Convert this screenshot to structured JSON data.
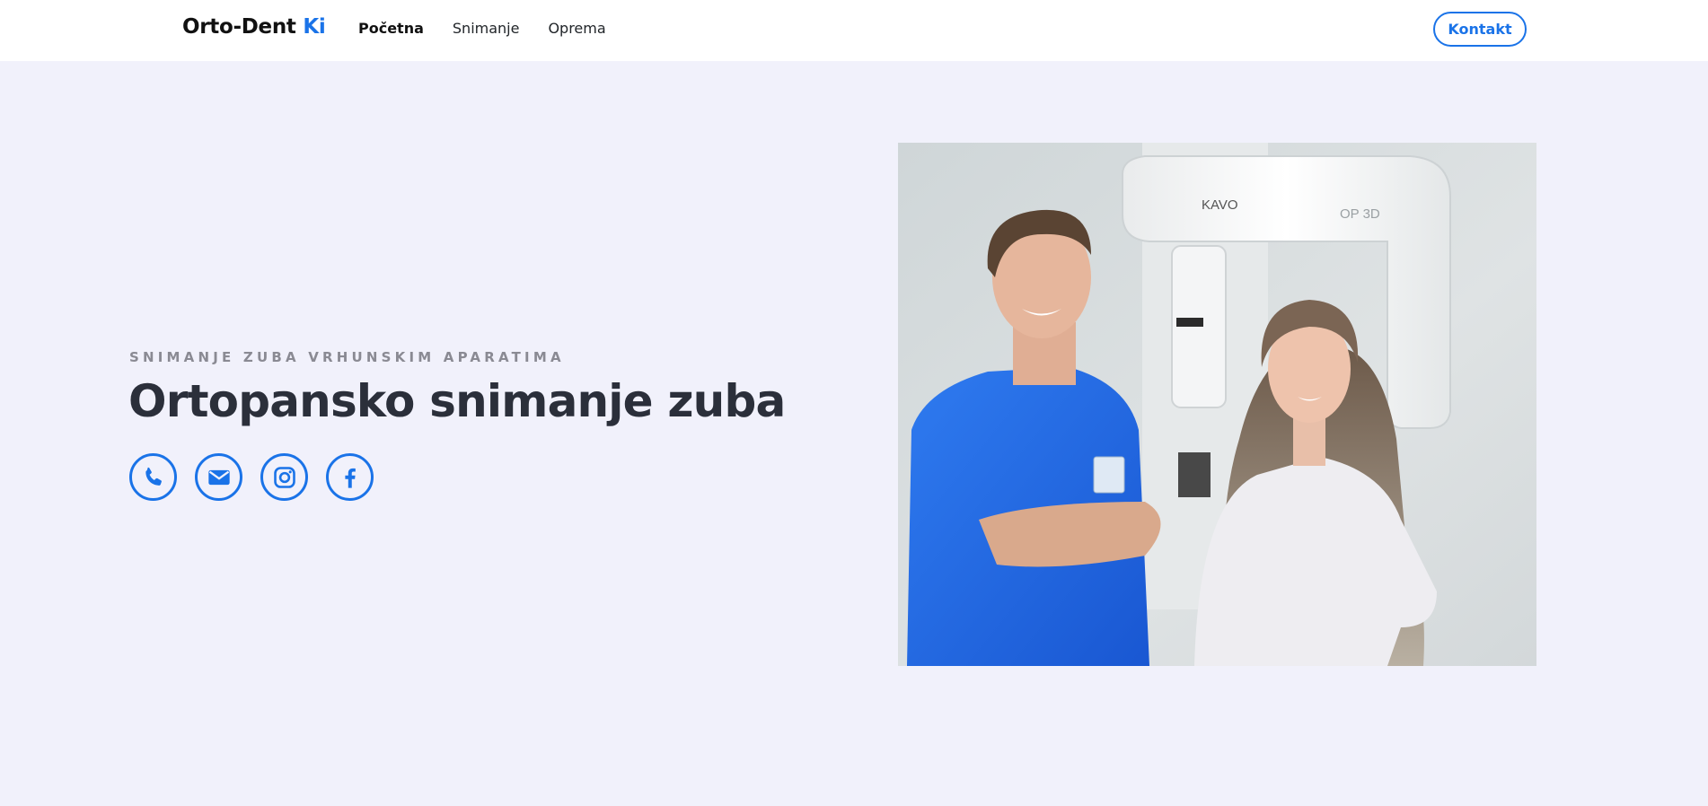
{
  "navbar": {
    "logo_main": "Orto-Dent",
    "logo_accent": "Ki",
    "links": [
      {
        "label": "Početna",
        "active": true
      },
      {
        "label": "Snimanje",
        "active": false
      },
      {
        "label": "Oprema",
        "active": false
      }
    ],
    "contact_label": "Kontakt"
  },
  "hero": {
    "eyebrow": "SNIMANJE ZUBA VRHUNSKIM APARATIMA",
    "title": "Ortopansko snimanje zuba",
    "social_icons": [
      "phone-icon",
      "mail-icon",
      "instagram-icon",
      "facebook-icon"
    ],
    "photo": {
      "device_brand": "KAVO",
      "device_model": "OP 3D"
    }
  },
  "colors": {
    "accent": "#1a73e8",
    "page_background": "#f1f1fb",
    "title": "#2b2f3a",
    "eyebrow": "#8a8a93"
  }
}
